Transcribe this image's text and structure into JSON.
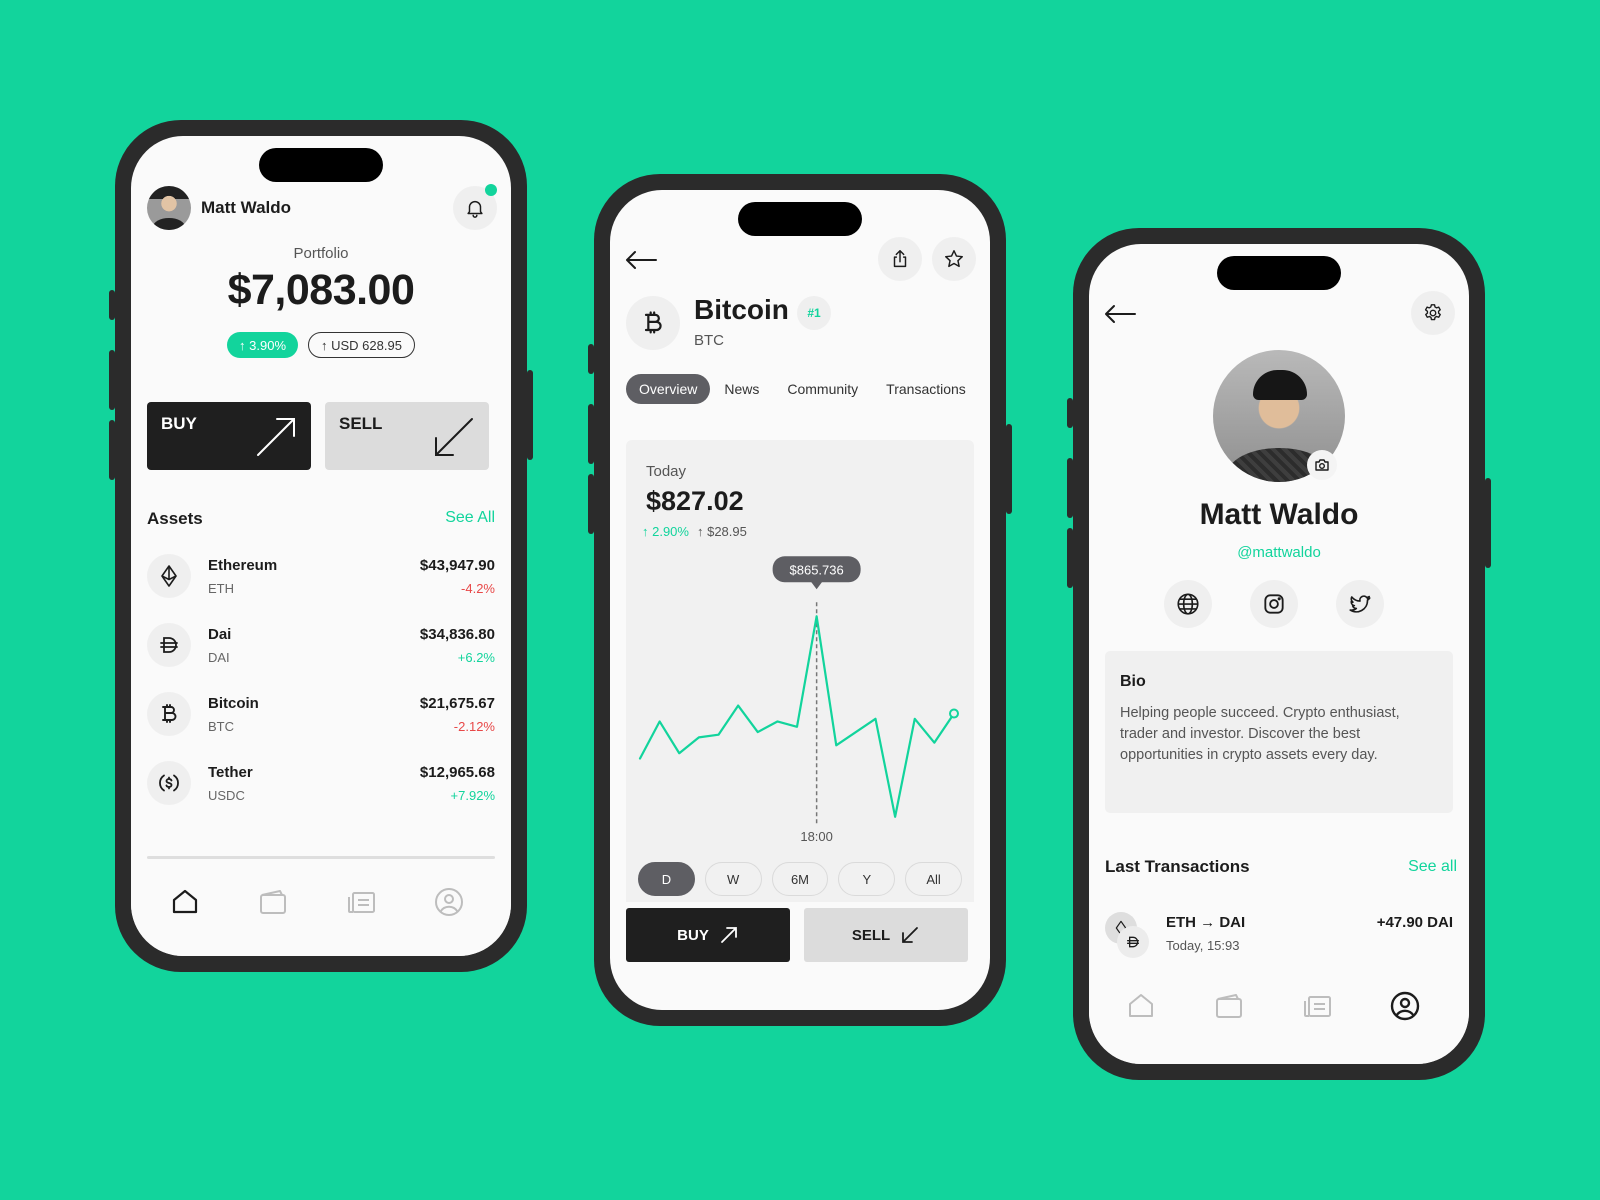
{
  "colors": {
    "background": "#12d49c",
    "accent": "#12d49c",
    "negative": "#e84848",
    "dark": "#1f1f1f",
    "frame": "#2b2b2b"
  },
  "portfolio_screen": {
    "user_name": "Matt Waldo",
    "notification_icon": "bell-icon",
    "portfolio_label": "Portfolio",
    "portfolio_value": "$7,083.00",
    "change_percent": "↑ 3.90%",
    "change_usd": "↑ USD 628.95",
    "buy_label": "BUY",
    "sell_label": "SELL",
    "assets_title": "Assets",
    "see_all_label": "See All",
    "assets": [
      {
        "name": "Ethereum",
        "symbol": "ETH",
        "price": "$43,947.90",
        "change": "-4.2%",
        "direction": "down",
        "icon": "ethereum-icon"
      },
      {
        "name": "Dai",
        "symbol": "DAI",
        "price": "$34,836.80",
        "change": "+6.2%",
        "direction": "up",
        "icon": "dai-icon"
      },
      {
        "name": "Bitcoin",
        "symbol": "BTC",
        "price": "$21,675.67",
        "change": "-2.12%",
        "direction": "down",
        "icon": "bitcoin-icon"
      },
      {
        "name": "Tether",
        "symbol": "USDC",
        "price": "$12,965.68",
        "change": "+7.92%",
        "direction": "up",
        "icon": "usdc-icon"
      }
    ],
    "tabbar": [
      "home-icon",
      "wallet-icon",
      "news-icon",
      "profile-icon"
    ],
    "active_tab": "home"
  },
  "coin_screen": {
    "coin_name": "Bitcoin",
    "coin_symbol": "BTC",
    "rank": "#1",
    "tabs": [
      {
        "label": "Overview",
        "active": true
      },
      {
        "label": "News",
        "active": false
      },
      {
        "label": "Community",
        "active": false
      },
      {
        "label": "Transactions",
        "active": false
      }
    ],
    "today_label": "Today",
    "today_value": "$827.02",
    "today_change_percent": "↑ 2.90%",
    "today_change_usd": "↑ $28.95",
    "ranges": [
      {
        "label": "D",
        "active": true
      },
      {
        "label": "W",
        "active": false
      },
      {
        "label": "6M",
        "active": false
      },
      {
        "label": "Y",
        "active": false
      },
      {
        "label": "All",
        "active": false
      }
    ],
    "buy_label": "BUY",
    "sell_label": "SELL"
  },
  "chart_data": {
    "type": "line",
    "title": "Today",
    "series": [
      {
        "name": "BTC price (D)",
        "values": [
          812,
          826,
          814,
          820,
          821,
          832,
          822,
          826,
          824,
          865.736,
          817,
          822,
          827,
          790,
          827,
          818,
          829
        ]
      }
    ],
    "tooltip": {
      "index": 9,
      "label": "$865.736"
    },
    "x_tick_labels": [
      {
        "index": 9,
        "label": "18:00"
      }
    ],
    "ylim": [
      785,
      870
    ],
    "grid": false,
    "xlabel": "",
    "ylabel": ""
  },
  "profile_screen": {
    "name": "Matt Waldo",
    "handle": "@mattwaldo",
    "socials": [
      "globe-icon",
      "instagram-icon",
      "twitter-icon"
    ],
    "bio_title": "Bio",
    "bio_text": "Helping people succeed. Crypto enthusiast, trader and investor. Discover the best opportunities in crypto assets every day.",
    "transactions_title": "Last Transactions",
    "see_all_label": "See all",
    "transactions": [
      {
        "title": "ETH → DAI",
        "time": "Today, 15:93",
        "amount": "+47.90 DAI"
      }
    ],
    "active_tab": "profile"
  }
}
